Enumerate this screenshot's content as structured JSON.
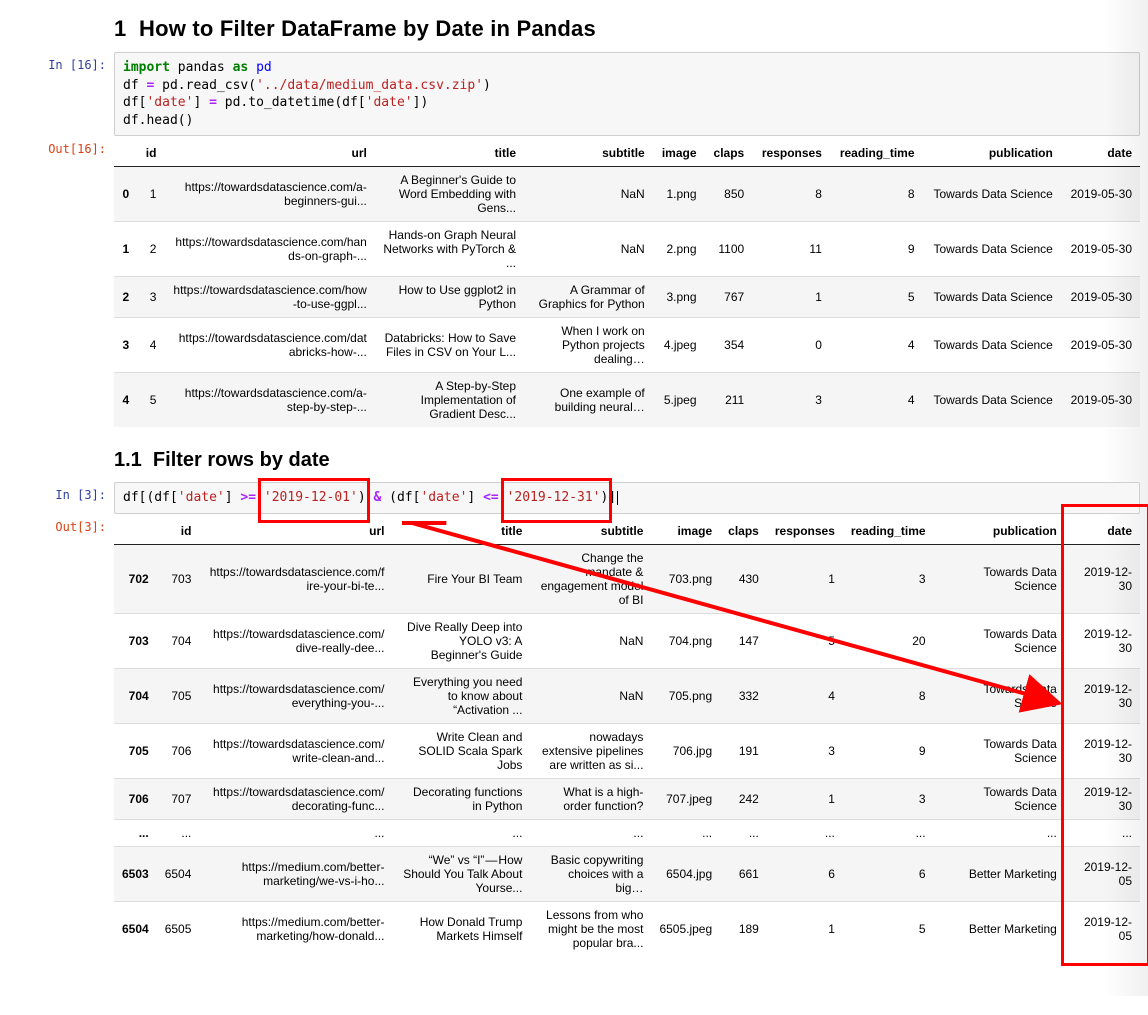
{
  "headings": {
    "h1": "1  How to Filter DataFrame by Date in Pandas",
    "h11": "1.1  Filter rows by date"
  },
  "cell1": {
    "in_label": "In [16]:",
    "out_label": "Out[16]:",
    "code": {
      "kw_import": "import",
      "mod": " pandas ",
      "kw_as": "as",
      "alias": " pd",
      "l2a": "df ",
      "l2eq": "=",
      "l2b": " pd.read_csv(",
      "l2s": "'../data/medium_data.csv.zip'",
      "l2c": ")",
      "l3a": "df[",
      "l3s1": "'date'",
      "l3b": "] ",
      "l3eq": "=",
      "l3c": " pd.to_datetime(df[",
      "l3s2": "'date'",
      "l3d": "])",
      "l4a": "df.head()"
    },
    "table": {
      "cols": [
        "",
        "id",
        "url",
        "title",
        "subtitle",
        "image",
        "claps",
        "responses",
        "reading_time",
        "publication",
        "date"
      ],
      "rows": [
        {
          "idx": "0",
          "id": "1",
          "url": "https://towardsdatascience.com/a-beginners-gui...",
          "title": "A Beginner's Guide to Word Embedding with Gens...",
          "subtitle": "NaN",
          "image": "1.png",
          "claps": "850",
          "responses": "8",
          "reading_time": "8",
          "publication": "Towards Data Science",
          "date": "2019-05-30"
        },
        {
          "idx": "1",
          "id": "2",
          "url": "https://towardsdatascience.com/hands-on-graph-...",
          "title": "Hands-on Graph Neural Networks with PyTorch & ...",
          "subtitle": "NaN",
          "image": "2.png",
          "claps": "1100",
          "responses": "11",
          "reading_time": "9",
          "publication": "Towards Data Science",
          "date": "2019-05-30"
        },
        {
          "idx": "2",
          "id": "3",
          "url": "https://towardsdatascience.com/how-to-use-ggpl...",
          "title": "How to Use ggplot2 in Python",
          "subtitle": "A Grammar of Graphics for Python",
          "image": "3.png",
          "claps": "767",
          "responses": "1",
          "reading_time": "5",
          "publication": "Towards Data Science",
          "date": "2019-05-30"
        },
        {
          "idx": "3",
          "id": "4",
          "url": "https://towardsdatascience.com/databricks-how-...",
          "title": "Databricks: How to Save Files in CSV on Your L...",
          "subtitle": "When I work on Python projects dealing…",
          "image": "4.jpeg",
          "claps": "354",
          "responses": "0",
          "reading_time": "4",
          "publication": "Towards Data Science",
          "date": "2019-05-30"
        },
        {
          "idx": "4",
          "id": "5",
          "url": "https://towardsdatascience.com/a-step-by-step-...",
          "title": "A Step-by-Step Implementation of Gradient Desc...",
          "subtitle": "One example of building neural…",
          "image": "5.jpeg",
          "claps": "211",
          "responses": "3",
          "reading_time": "4",
          "publication": "Towards Data Science",
          "date": "2019-05-30"
        }
      ]
    }
  },
  "cell2": {
    "in_label": "In [3]:",
    "out_label": "Out[3]:",
    "code": {
      "a": "df[(df[",
      "s1": "'date'",
      "b": "] ",
      "op1": ">=",
      "c": " ",
      "s2": "'2019-12-01'",
      "d": ") ",
      "op2": "&",
      "e": " (df[",
      "s3": "'date'",
      "f": "] ",
      "op3": "<=",
      "g": " ",
      "s4": "'2019-12-31'",
      "h": ")]"
    },
    "table": {
      "cols": [
        "",
        "id",
        "url",
        "title",
        "subtitle",
        "image",
        "claps",
        "responses",
        "reading_time",
        "publication",
        "date"
      ],
      "rows": [
        {
          "idx": "702",
          "id": "703",
          "url": "https://towardsdatascience.com/fire-your-bi-te...",
          "title": "Fire Your BI Team",
          "subtitle": "Change the mandate & engagement model of BI",
          "image": "703.png",
          "claps": "430",
          "responses": "1",
          "reading_time": "3",
          "publication": "Towards Data Science",
          "date": "2019-12-30"
        },
        {
          "idx": "703",
          "id": "704",
          "url": "https://towardsdatascience.com/dive-really-dee...",
          "title": "Dive Really Deep into YOLO v3: A Beginner's Guide",
          "subtitle": "NaN",
          "image": "704.png",
          "claps": "147",
          "responses": "5",
          "reading_time": "20",
          "publication": "Towards Data Science",
          "date": "2019-12-30"
        },
        {
          "idx": "704",
          "id": "705",
          "url": "https://towardsdatascience.com/everything-you-...",
          "title": "Everything you need to know about “Activation ...",
          "subtitle": "NaN",
          "image": "705.png",
          "claps": "332",
          "responses": "4",
          "reading_time": "8",
          "publication": "Towards Data Science",
          "date": "2019-12-30"
        },
        {
          "idx": "705",
          "id": "706",
          "url": "https://towardsdatascience.com/write-clean-and...",
          "title": "Write Clean and SOLID Scala Spark Jobs",
          "subtitle": "nowadays extensive pipelines are written as si...",
          "image": "706.jpg",
          "claps": "191",
          "responses": "3",
          "reading_time": "9",
          "publication": "Towards Data Science",
          "date": "2019-12-30"
        },
        {
          "idx": "706",
          "id": "707",
          "url": "https://towardsdatascience.com/decorating-func...",
          "title": "Decorating functions in Python",
          "subtitle": "What is a high-order function?",
          "image": "707.jpeg",
          "claps": "242",
          "responses": "1",
          "reading_time": "3",
          "publication": "Towards Data Science",
          "date": "2019-12-30"
        },
        {
          "idx": "...",
          "id": "...",
          "url": "...",
          "title": "...",
          "subtitle": "...",
          "image": "...",
          "claps": "...",
          "responses": "...",
          "reading_time": "...",
          "publication": "...",
          "date": "..."
        },
        {
          "idx": "6503",
          "id": "6504",
          "url": "https://medium.com/better-marketing/we-vs-i-ho...",
          "title": "“We” vs “I” — How Should You Talk About Yourse...",
          "subtitle": "Basic copywriting choices with a big…",
          "image": "6504.jpg",
          "claps": "661",
          "responses": "6",
          "reading_time": "6",
          "publication": "Better Marketing",
          "date": "2019-12-05"
        },
        {
          "idx": "6504",
          "id": "6505",
          "url": "https://medium.com/better-marketing/how-donald...",
          "title": "How Donald Trump Markets Himself",
          "subtitle": "Lessons from who might be the most popular bra...",
          "image": "6505.jpeg",
          "claps": "189",
          "responses": "1",
          "reading_time": "5",
          "publication": "Better Marketing",
          "date": "2019-12-05"
        }
      ]
    }
  }
}
